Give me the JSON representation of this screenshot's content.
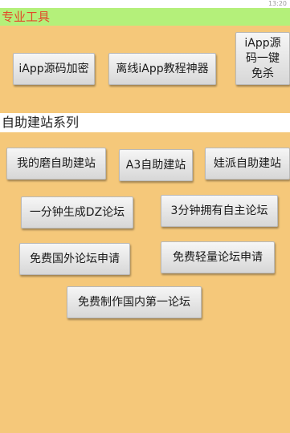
{
  "statusbar": {
    "text": "13:20"
  },
  "sections": {
    "tools_title": "专业工具",
    "sites_title": "自助建站系列"
  },
  "buttons": {
    "iapp_encrypt": "iApp源码加密",
    "offline_tutorial": "离线iApp教程神器",
    "one_click_free": "iApp源\n码一键\n免杀",
    "wode_mo": "我的磨自助建站",
    "a3": "A3自助建站",
    "wapai": "娃派自助建站",
    "dz_forum": "一分钟生成DZ论坛",
    "own_forum": "3分钟拥有自主论坛",
    "foreign_forum": "免费国外论坛申请",
    "light_forum": "免费轻量论坛申请",
    "domestic_forum": "免费制作国内第一论坛"
  }
}
